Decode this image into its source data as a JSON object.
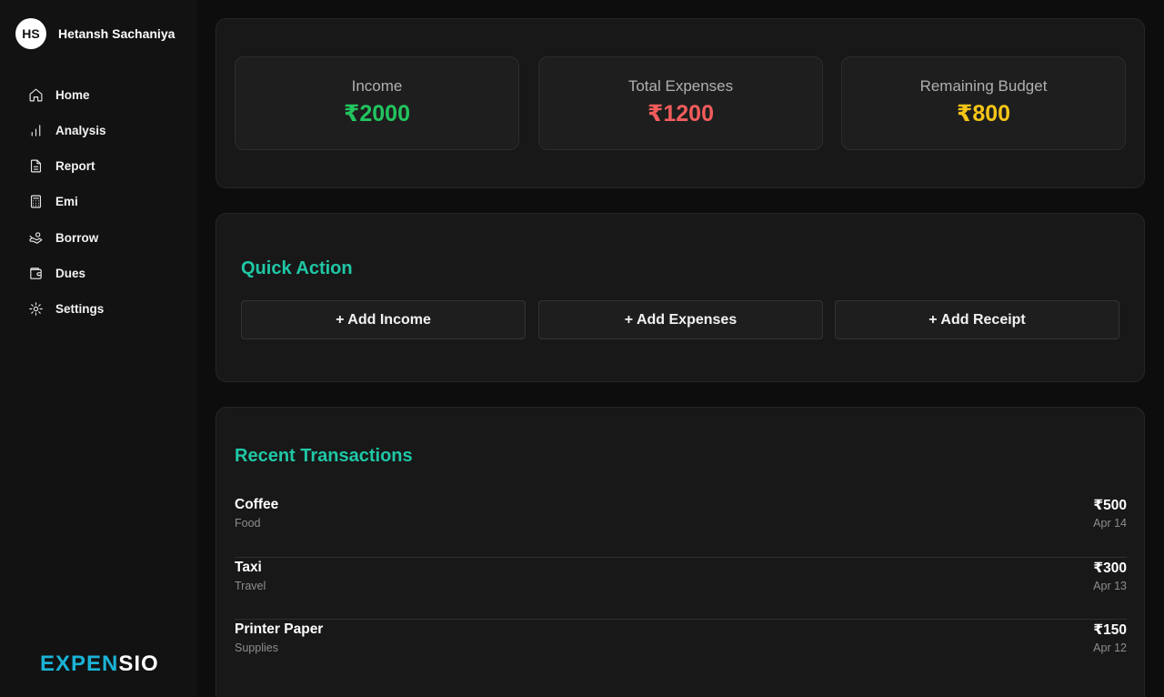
{
  "user": {
    "initials": "HS",
    "name": "Hetansh Sachaniya"
  },
  "nav": [
    {
      "label": "Home",
      "icon": "home-icon"
    },
    {
      "label": "Analysis",
      "icon": "bar-chart-icon"
    },
    {
      "label": "Report",
      "icon": "document-icon"
    },
    {
      "label": "Emi",
      "icon": "calculator-icon"
    },
    {
      "label": "Borrow",
      "icon": "hand-coins-icon"
    },
    {
      "label": "Dues",
      "icon": "wallet-icon"
    },
    {
      "label": "Settings",
      "icon": "gear-icon"
    }
  ],
  "logo": {
    "part1": "EXPEN",
    "part2": "SIO",
    "color1": "#1ab3d6",
    "color2": "#ffffff"
  },
  "stats": [
    {
      "label": "Income",
      "value": "₹2000",
      "color": "#22c55e"
    },
    {
      "label": "Total Expenses",
      "value": "₹1200",
      "color": "#f25c5c"
    },
    {
      "label": "Remaining Budget",
      "value": "₹800",
      "color": "#f5c518"
    }
  ],
  "quick_action": {
    "title": "Quick Action",
    "buttons": [
      "+ Add Income",
      "+ Add Expenses",
      "+ Add Receipt"
    ]
  },
  "recent": {
    "title": "Recent Transactions",
    "items": [
      {
        "name": "Coffee",
        "category": "Food",
        "amount": "₹500",
        "date": "Apr 14"
      },
      {
        "name": "Taxi",
        "category": "Travel",
        "amount": "₹300",
        "date": "Apr 13"
      },
      {
        "name": "Printer Paper",
        "category": "Supplies",
        "amount": "₹150",
        "date": "Apr 12"
      }
    ]
  },
  "colors": {
    "accent": "#1fc7a6"
  }
}
